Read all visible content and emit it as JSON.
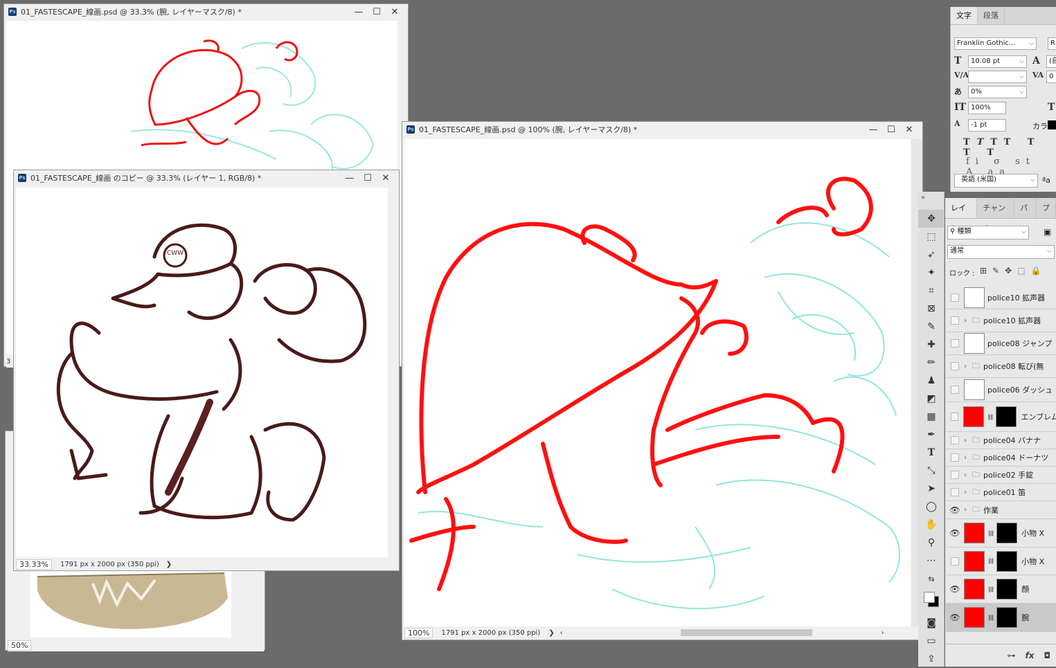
{
  "window1": {
    "title": "01_FASTESCAPE_線画.psd @ 33.3% (腕, レイヤーマスク/8) *",
    "zoom": "3"
  },
  "window2": {
    "title": "01_FASTESCAPE_線画 のコピー @ 33.3% (レイヤー 1, RGB/8) *",
    "zoom": "33.33%",
    "info": "1791 px x 2000 px (350 ppi)",
    "badge_text": "CWW"
  },
  "window3": {
    "zoom": "50%"
  },
  "window4": {
    "title": "01_FASTESCAPE_線画.psd @ 100% (腕, レイヤーマスク/8) *",
    "zoom": "100%",
    "info": "1791 px x 2000 px (350 ppi)"
  },
  "icons": {
    "ps": "Ps",
    "minimize": "—",
    "maximize": "☐",
    "close": "✕",
    "arrow": "❯",
    "left": "‹",
    "right": "›"
  },
  "char_panel": {
    "tabs": [
      "文字",
      "段落"
    ],
    "font": "Franklin Gothic...",
    "font_style": "R",
    "size": "10.08 pt",
    "leading": "(自",
    "kerning": "",
    "tracking": "0",
    "scale_pct": "0%",
    "vscale": "100%",
    "hscale": "T",
    "baseline": "-1 pt",
    "color_label": "カラー",
    "language": "英語 (米国)",
    "aa": "ªa"
  },
  "layers_panel": {
    "tabs": [
      "レイヤー",
      "チャンネル",
      "パス",
      "プ"
    ],
    "filter": "種類",
    "blend": "通常",
    "lock_label": "ロック :",
    "layers": [
      {
        "name": "police10 拡声器",
        "type": "layer",
        "visible": false
      },
      {
        "name": "police10 拡声器",
        "type": "group",
        "visible": false
      },
      {
        "name": "police08 ジャンプ",
        "type": "layer",
        "visible": false
      },
      {
        "name": "police08 転び(無",
        "type": "group",
        "visible": false
      },
      {
        "name": "police06 ダッシュ",
        "type": "layer",
        "visible": false
      },
      {
        "name": "エンブレム",
        "type": "masked",
        "visible": false
      },
      {
        "name": "police04 バナナ",
        "type": "group",
        "visible": false
      },
      {
        "name": "police04 ドーナツ",
        "type": "group",
        "visible": false
      },
      {
        "name": "police02 手錠",
        "type": "group",
        "visible": false
      },
      {
        "name": "police01 笛",
        "type": "group",
        "visible": false
      },
      {
        "name": "作業",
        "type": "group",
        "visible": true
      },
      {
        "name": "小物 X",
        "type": "masked",
        "visible": true
      },
      {
        "name": "小物 X",
        "type": "masked",
        "visible": false
      },
      {
        "name": "顔",
        "type": "masked",
        "visible": true
      },
      {
        "name": "腕",
        "type": "masked",
        "visible": true
      }
    ]
  },
  "tools": [
    "move",
    "marquee",
    "lasso",
    "magic-wand",
    "crop",
    "frame",
    "eyedropper",
    "heal",
    "brush",
    "stamp",
    "eraser",
    "gradient",
    "pen",
    "type",
    "path-select",
    "direct-select",
    "ellipse",
    "hand",
    "zoom",
    "more",
    "swap",
    "fg-bg",
    "quickmask",
    "screen-mode",
    "share"
  ]
}
